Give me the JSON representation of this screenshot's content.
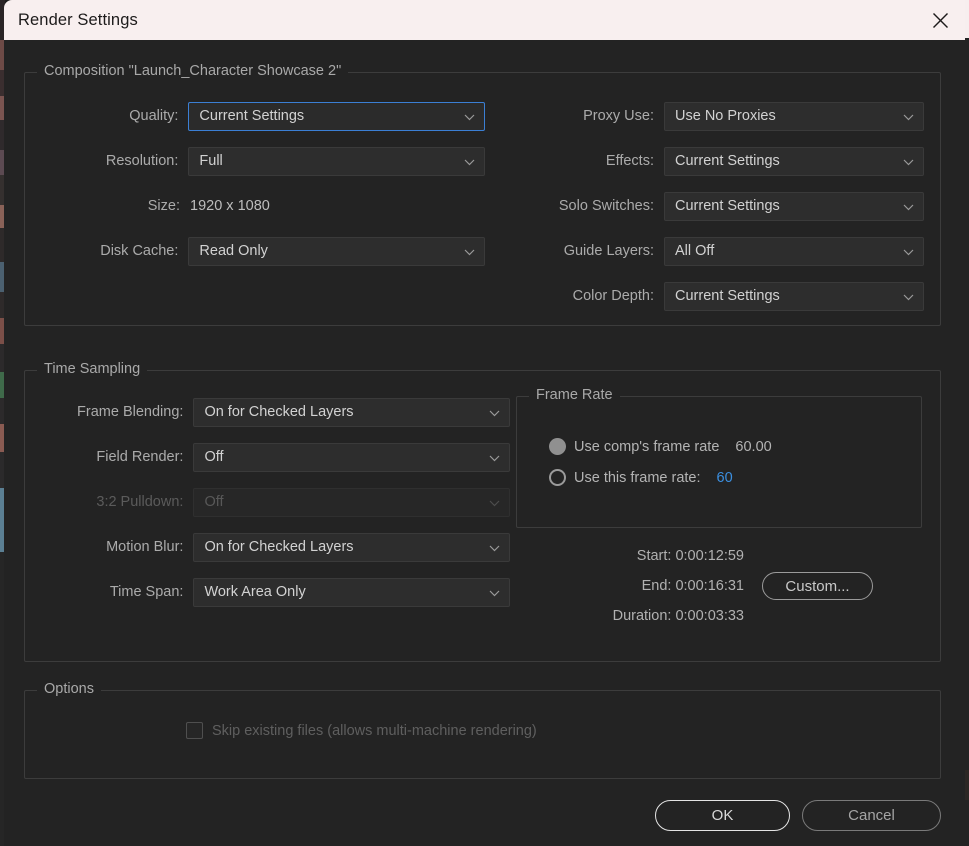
{
  "window": {
    "title": "Render Settings",
    "close_icon": "close-icon"
  },
  "composition_group": {
    "title": "Composition \"Launch_Character Showcase 2\"",
    "left_fields": [
      {
        "label": "Quality:",
        "value": "Current Settings",
        "focused": true,
        "type": "dropdown"
      },
      {
        "label": "Resolution:",
        "value": "Full",
        "focused": false,
        "type": "dropdown"
      },
      {
        "label": "Size:",
        "value": "1920 x 1080",
        "type": "static"
      },
      {
        "label": "Disk Cache:",
        "value": "Read Only",
        "focused": false,
        "type": "dropdown"
      }
    ],
    "right_fields": [
      {
        "label": "Proxy Use:",
        "value": "Use No Proxies",
        "type": "dropdown"
      },
      {
        "label": "Effects:",
        "value": "Current Settings",
        "type": "dropdown"
      },
      {
        "label": "Solo Switches:",
        "value": "Current Settings",
        "type": "dropdown"
      },
      {
        "label": "Guide Layers:",
        "value": "All Off",
        "type": "dropdown"
      },
      {
        "label": "Color Depth:",
        "value": "Current Settings",
        "type": "dropdown"
      }
    ]
  },
  "time_sampling_group": {
    "title": "Time Sampling",
    "fields": [
      {
        "label": "Frame Blending:",
        "value": "On for Checked Layers",
        "disabled": false
      },
      {
        "label": "Field Render:",
        "value": "Off",
        "disabled": false
      },
      {
        "label": "3:2 Pulldown:",
        "value": "Off",
        "disabled": true
      },
      {
        "label": "Motion Blur:",
        "value": "On for Checked Layers",
        "disabled": false
      },
      {
        "label": "Time Span:",
        "value": "Work Area Only",
        "disabled": false
      }
    ],
    "frame_rate": {
      "title": "Frame Rate",
      "option_comp": {
        "label": "Use comp's frame rate",
        "value": "60.00",
        "selected": true
      },
      "option_this": {
        "label": "Use this frame rate:",
        "value": "60",
        "selected": false
      }
    },
    "times": {
      "start": "Start: 0:00:12:59",
      "end": "End: 0:00:16:31",
      "duration": "Duration: 0:00:03:33",
      "custom_button": "Custom..."
    }
  },
  "options_group": {
    "title": "Options",
    "skip_existing": {
      "label": "Skip existing files (allows multi-machine rendering)",
      "checked": false,
      "disabled": true
    }
  },
  "footer": {
    "ok": "OK",
    "cancel": "Cancel"
  },
  "colors": {
    "accent_blue": "#3b8fe0",
    "focus_border": "#3b7fd4",
    "titlebar_bg": "#f8efef",
    "dialog_bg": "#232323",
    "field_bg": "#2d2d2d"
  }
}
